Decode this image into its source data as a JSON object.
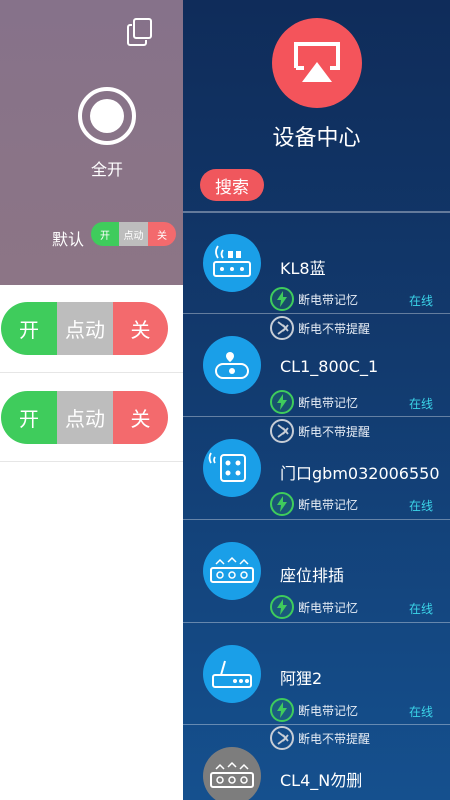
{
  "left": {
    "all_on_label": "全开",
    "default_label": "默认",
    "mini_switch": {
      "on": "开",
      "mid": "点动",
      "off": "关"
    },
    "rows": [
      {
        "on": "开",
        "mid": "点动",
        "off": "关"
      },
      {
        "on": "开",
        "mid": "点动",
        "off": "关"
      }
    ]
  },
  "right": {
    "title": "设备中心",
    "search_label": "搜索",
    "devices": [
      {
        "name": "KL8蓝",
        "memory": "断电带记忆",
        "status": "在线",
        "no_alert": "断电不带提醒",
        "icon": "wifi-socket-icon",
        "color": "#1a9fe8"
      },
      {
        "name": "CL1_800C_1",
        "memory": "断电带记忆",
        "status": "在线",
        "no_alert": "断电不带提醒",
        "icon": "location-plug-icon",
        "color": "#1a9fe8"
      },
      {
        "name": "门口gbm032006550",
        "memory": "断电带记忆",
        "status": "在线",
        "icon": "wifi-outlet-icon",
        "color": "#1a9fe8"
      },
      {
        "name": "座位排插",
        "memory": "断电带记忆",
        "status": "在线",
        "icon": "power-strip-icon",
        "color": "#1a9fe8"
      },
      {
        "name": "阿狸2",
        "memory": "断电带记忆",
        "status": "在线",
        "no_alert": "断电不带提醒",
        "icon": "router-icon",
        "color": "#1a9fe8"
      },
      {
        "name": "CL4_N勿删",
        "icon": "power-strip-offline-icon",
        "color": "#7d7d7d"
      }
    ]
  }
}
